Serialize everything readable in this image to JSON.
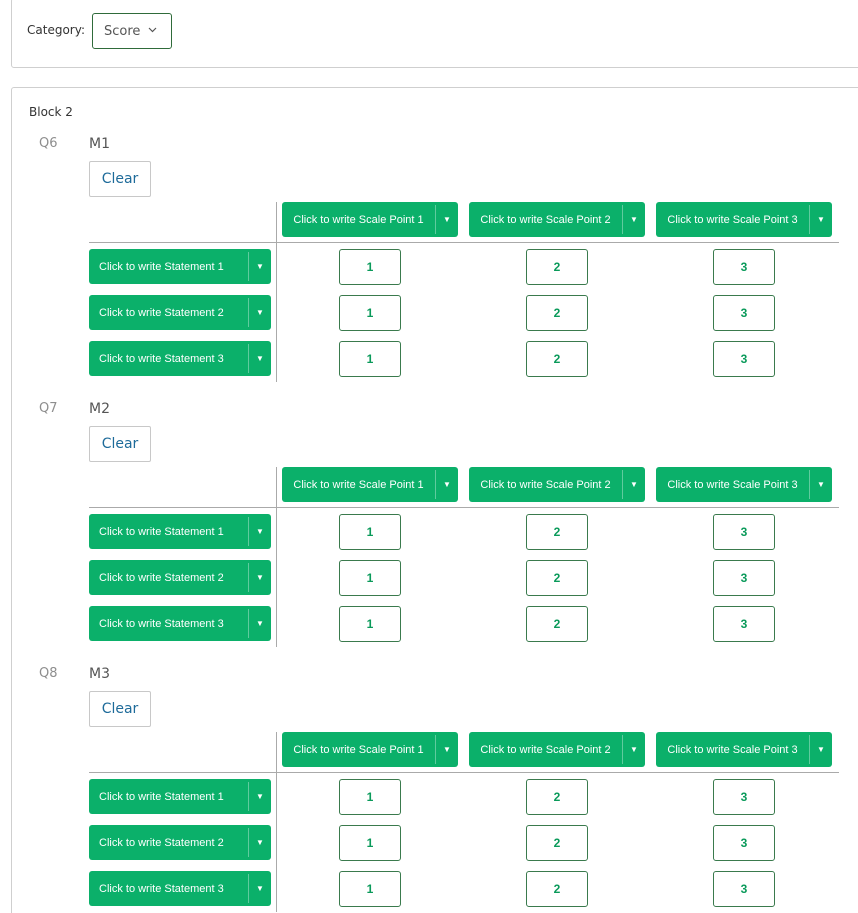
{
  "category": {
    "label": "Category:",
    "selected": "Score",
    "chevron_icon": "chevron-down-icon"
  },
  "block": {
    "title": "Block 2",
    "questions": [
      {
        "id": "Q6",
        "title": "M1",
        "clear_label": "Clear",
        "scale_points": [
          "Click to write Scale Point 1",
          "Click to write Scale Point 2",
          "Click to write Scale Point 3"
        ],
        "statements": [
          "Click to write Statement 1",
          "Click to write Statement 2",
          "Click to write Statement 3"
        ],
        "cells": [
          [
            "1",
            "2",
            "3"
          ],
          [
            "1",
            "2",
            "3"
          ],
          [
            "1",
            "2",
            "3"
          ]
        ]
      },
      {
        "id": "Q7",
        "title": "M2",
        "clear_label": "Clear",
        "scale_points": [
          "Click to write Scale Point 1",
          "Click to write Scale Point 2",
          "Click to write Scale Point 3"
        ],
        "statements": [
          "Click to write Statement 1",
          "Click to write Statement 2",
          "Click to write Statement 3"
        ],
        "cells": [
          [
            "1",
            "2",
            "3"
          ],
          [
            "1",
            "2",
            "3"
          ],
          [
            "1",
            "2",
            "3"
          ]
        ]
      },
      {
        "id": "Q8",
        "title": "M3",
        "clear_label": "Clear",
        "scale_points": [
          "Click to write Scale Point 1",
          "Click to write Scale Point 2",
          "Click to write Scale Point 3"
        ],
        "statements": [
          "Click to write Statement 1",
          "Click to write Statement 2",
          "Click to write Statement 3"
        ],
        "cells": [
          [
            "1",
            "2",
            "3"
          ],
          [
            "1",
            "2",
            "3"
          ],
          [
            "1",
            "2",
            "3"
          ]
        ]
      }
    ]
  },
  "colors": {
    "accent_green": "#0bb06a",
    "cell_text": "#0a9a5a",
    "clear_text": "#1e6b9a"
  }
}
